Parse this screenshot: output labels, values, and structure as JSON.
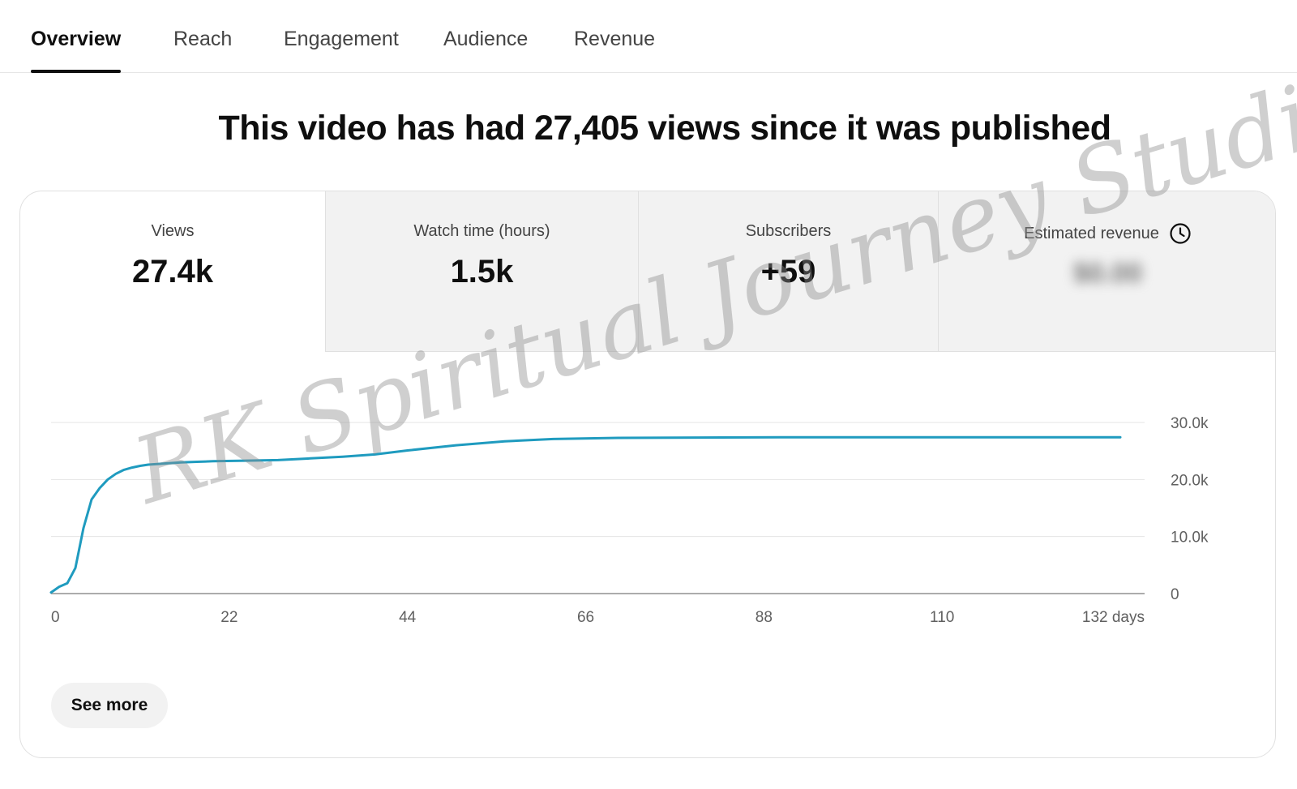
{
  "tabs": [
    {
      "label": "Overview",
      "active": true
    },
    {
      "label": "Reach",
      "active": false
    },
    {
      "label": "Engagement",
      "active": false
    },
    {
      "label": "Audience",
      "active": false
    },
    {
      "label": "Revenue",
      "active": false
    }
  ],
  "headline": "This video has had 27,405 views since it was published",
  "metrics": [
    {
      "label": "Views",
      "value": "27.4k"
    },
    {
      "label": "Watch time (hours)",
      "value": "1.5k"
    },
    {
      "label": "Subscribers",
      "value": "+59"
    },
    {
      "label": "Estimated revenue",
      "value": "$0.00",
      "icon": "clock-icon",
      "blurred": true
    }
  ],
  "see_more_label": "See more",
  "watermark": "RK Spiritual Journey Studio",
  "colors": {
    "line": "#1f9bbf",
    "grid": "#e5e5e5"
  },
  "chart_data": {
    "type": "line",
    "series": [
      {
        "x": [
          0,
          1,
          2,
          3,
          4,
          5,
          6,
          7,
          8,
          9,
          10,
          11,
          12,
          14,
          16,
          18,
          20,
          24,
          28,
          32,
          36,
          40,
          44,
          50,
          56,
          62,
          70,
          80,
          90,
          100,
          110,
          120,
          132
        ],
        "values": [
          200,
          1200,
          1800,
          4500,
          11500,
          16500,
          18500,
          20000,
          21000,
          21700,
          22100,
          22400,
          22600,
          22800,
          23000,
          23100,
          23200,
          23300,
          23400,
          23700,
          24000,
          24400,
          25100,
          26000,
          26700,
          27100,
          27300,
          27350,
          27400,
          27400,
          27400,
          27405,
          27405
        ]
      }
    ],
    "x_ticks": [
      "0",
      "22",
      "44",
      "66",
      "88",
      "110",
      "132 days"
    ],
    "x_tick_values": [
      0,
      22,
      44,
      66,
      88,
      110,
      132
    ],
    "y_ticks": [
      "0",
      "10.0k",
      "20.0k",
      "30.0k"
    ],
    "y_tick_values": [
      0,
      10000,
      20000,
      30000
    ],
    "xlim": [
      0,
      135
    ],
    "ylim": [
      0,
      30000
    ],
    "grid": true,
    "y_axis_position": "right"
  }
}
